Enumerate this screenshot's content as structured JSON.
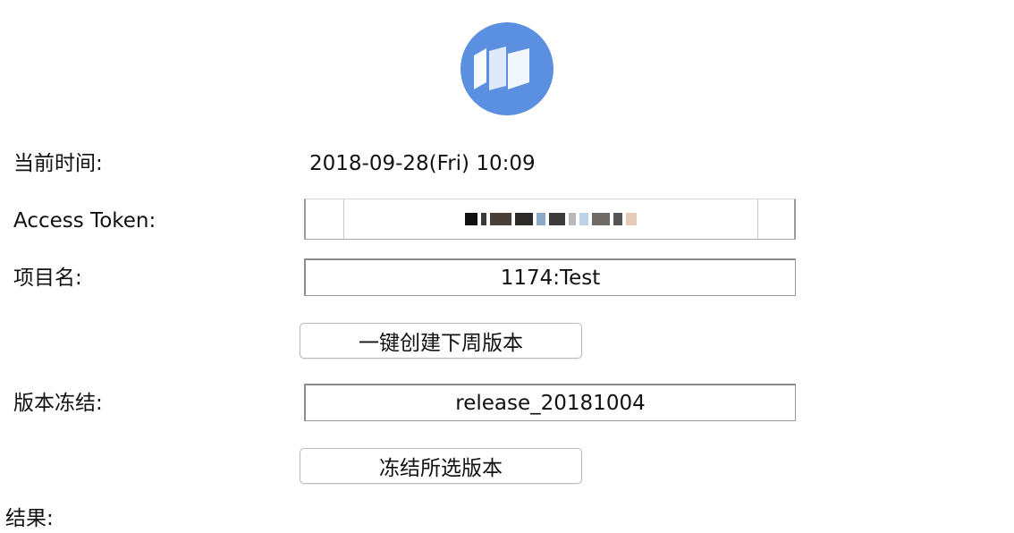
{
  "logo": {
    "icon": "app-logo-icon",
    "color": "#5b8fe0"
  },
  "rows": {
    "current_time": {
      "label": "当前时间:",
      "value": "2018-09-28(Fri) 10:09"
    },
    "access_token": {
      "label": "Access Token:",
      "value": "",
      "note": "obscured"
    },
    "project": {
      "label": "项目名:",
      "value": "1174:Test"
    },
    "create_button": {
      "label": "一键创建下周版本"
    },
    "version_freeze": {
      "label": "版本冻结:",
      "value": "release_20181004"
    },
    "freeze_button": {
      "label": "冻结所选版本"
    },
    "result": {
      "label": "结果:"
    }
  }
}
